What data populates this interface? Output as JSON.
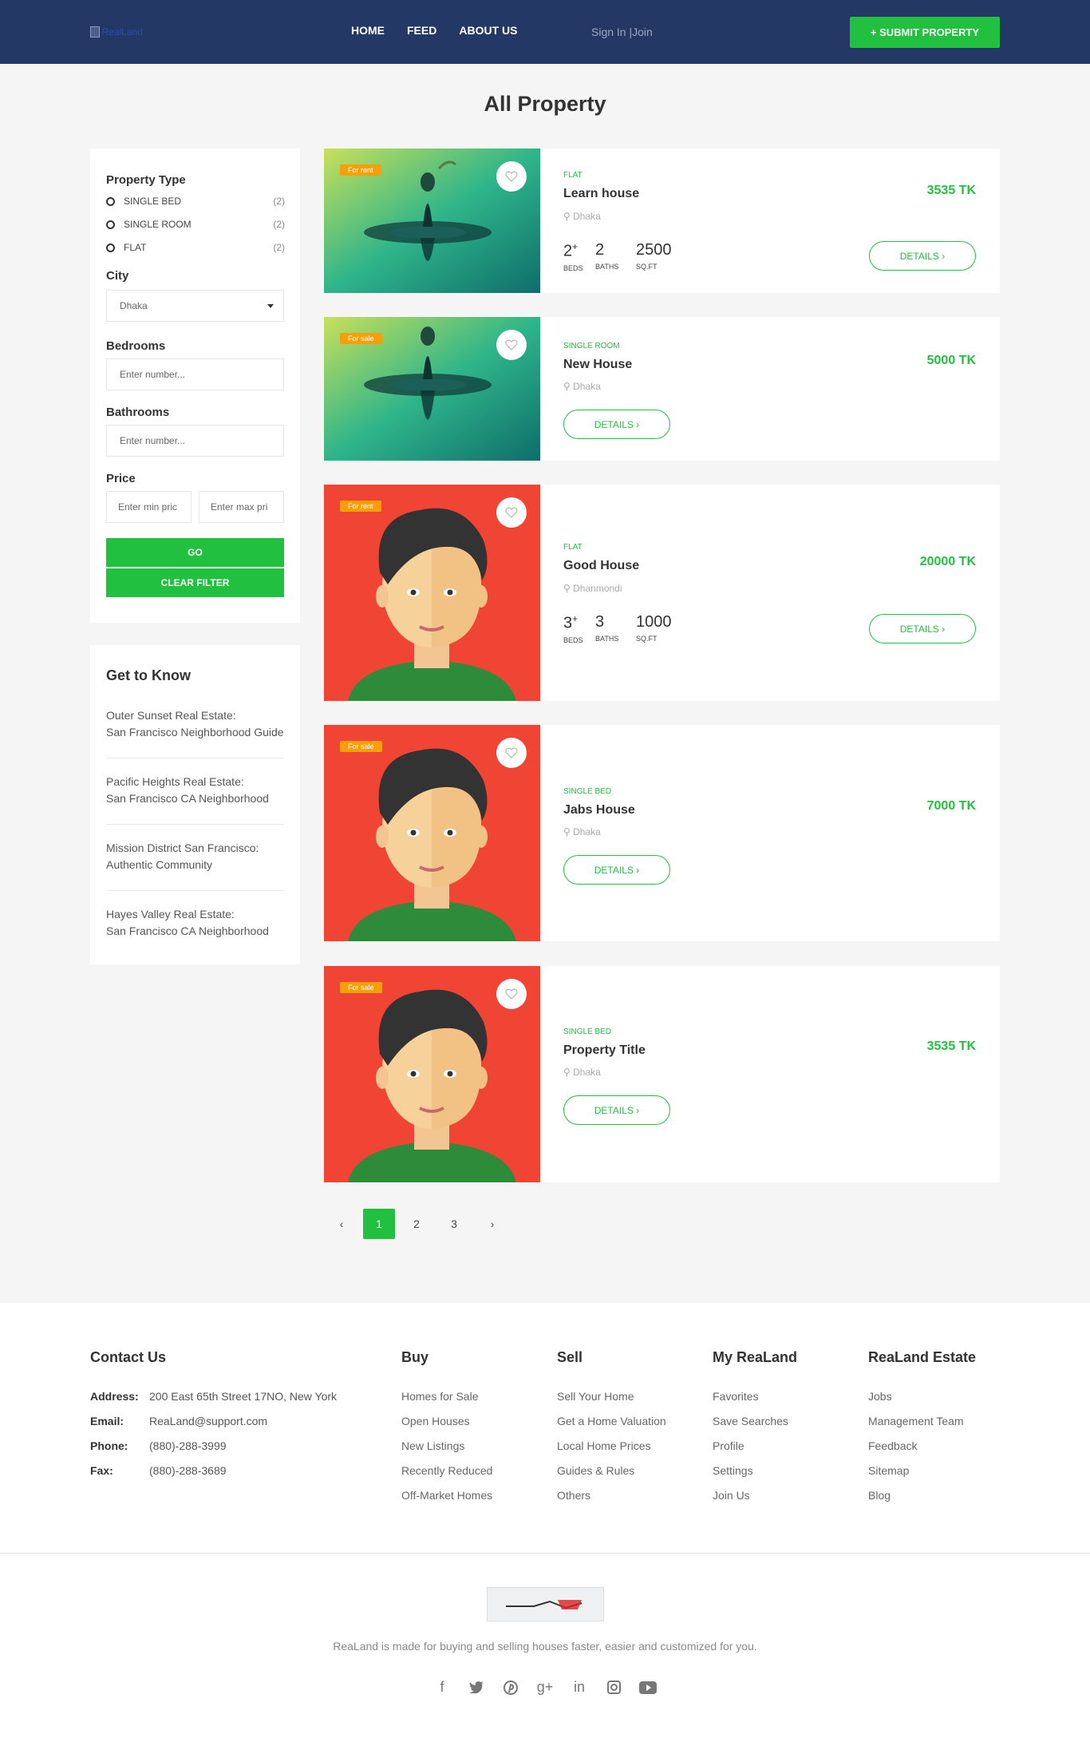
{
  "header": {
    "logo_alt": "RealLand",
    "nav": [
      "HOME",
      "FEED",
      "ABOUT US"
    ],
    "signin": "Sign In |Join",
    "submit": "+ SUBMIT PROPERTY"
  },
  "page_title": "All Property",
  "filter": {
    "property_type_label": "Property Type",
    "types": [
      {
        "label": "SINGLE BED",
        "count": "(2)"
      },
      {
        "label": "SINGLE ROOM",
        "count": "(2)"
      },
      {
        "label": "FLAT",
        "count": "(2)"
      }
    ],
    "city_label": "City",
    "city_value": "Dhaka",
    "bedrooms_label": "Bedrooms",
    "bedrooms_placeholder": "Enter number...",
    "bathrooms_label": "Bathrooms",
    "bathrooms_placeholder": "Enter number...",
    "price_label": "Price",
    "min_placeholder": "Enter min pric",
    "max_placeholder": "Enter max pri",
    "go": "GO",
    "clear": "CLEAR FILTER"
  },
  "get_to_know": {
    "title": "Get to Know",
    "items": [
      {
        "line1": "Outer Sunset Real Estate:",
        "line2": "San Francisco Neighborhood Guide"
      },
      {
        "line1": "Pacific Heights Real Estate:",
        "line2": "San Francisco CA Neighborhood"
      },
      {
        "line1": "Mission District San Francisco:",
        "line2": "Authentic Community"
      },
      {
        "line1": "Hayes Valley Real Estate:",
        "line2": "San Francisco CA Neighborhood"
      }
    ]
  },
  "properties": [
    {
      "badge": "For rent",
      "type": "FLAT",
      "name": "Learn house",
      "location": "Dhaka",
      "price": "3535 TK",
      "details": "DETAILS ›",
      "beds": "2",
      "baths": "2",
      "sqft": "2500",
      "image": "water-drop"
    },
    {
      "badge": "For sale",
      "type": "SINGLE ROOM",
      "name": "New House",
      "location": "Dhaka",
      "price": "5000 TK",
      "details": "DETAILS ›",
      "image": "water-drop"
    },
    {
      "badge": "For rent",
      "type": "FLAT",
      "name": "Good House",
      "location": "Dhanmondi",
      "price": "20000 TK",
      "details": "DETAILS ›",
      "beds": "3",
      "baths": "3",
      "sqft": "1000",
      "image": "avatar"
    },
    {
      "badge": "For sale",
      "type": "SINGLE BED",
      "name": "Jabs House",
      "location": "Dhaka",
      "price": "7000 TK",
      "details": "DETAILS ›",
      "image": "avatar"
    },
    {
      "badge": "For sale",
      "type": "SINGLE BED",
      "name": "Property Title",
      "location": "Dhaka",
      "price": "3535 TK",
      "details": "DETAILS ›",
      "image": "avatar"
    }
  ],
  "stat_units": {
    "beds": "BEDS",
    "baths": "BATHS",
    "sqft": "SQ.FT"
  },
  "pagination": {
    "prev": "‹",
    "pages": [
      "1",
      "2",
      "3"
    ],
    "active": "1",
    "next": "›"
  },
  "footer": {
    "contact": {
      "title": "Contact Us",
      "address_label": "Address:",
      "address": "200 East 65th Street 17NO, New York",
      "email_label": "Email:",
      "email": "ReaLand@support.com",
      "phone_label": "Phone:",
      "phone": "(880)-288-3999",
      "fax_label": "Fax:",
      "fax": "(880)-288-3689"
    },
    "columns": [
      {
        "title": "Buy",
        "links": [
          "Homes for Sale",
          "Open Houses",
          "New Listings",
          "Recently Reduced",
          "Off-Market Homes"
        ]
      },
      {
        "title": "Sell",
        "links": [
          "Sell Your Home",
          "Get a Home Valuation",
          "Local Home Prices",
          "Guides & Rules",
          "Others"
        ]
      },
      {
        "title": "My ReaLand",
        "links": [
          "Favorites",
          "Save Searches",
          "Profile",
          "Settings",
          "Join Us"
        ]
      },
      {
        "title": "ReaLand Estate",
        "links": [
          "Jobs",
          "Management Team",
          "Feedback",
          "Sitemap",
          "Blog"
        ]
      }
    ],
    "tagline": "ReaLand is made for buying and selling houses faster, easier and customized for you.",
    "social": [
      "facebook-icon",
      "twitter-icon",
      "pinterest-icon",
      "google-plus-icon",
      "linkedin-icon",
      "instagram-icon",
      "youtube-icon"
    ]
  },
  "colors": {
    "header": "#233865",
    "accent": "#22c03f",
    "badge": "#f5a00a"
  }
}
